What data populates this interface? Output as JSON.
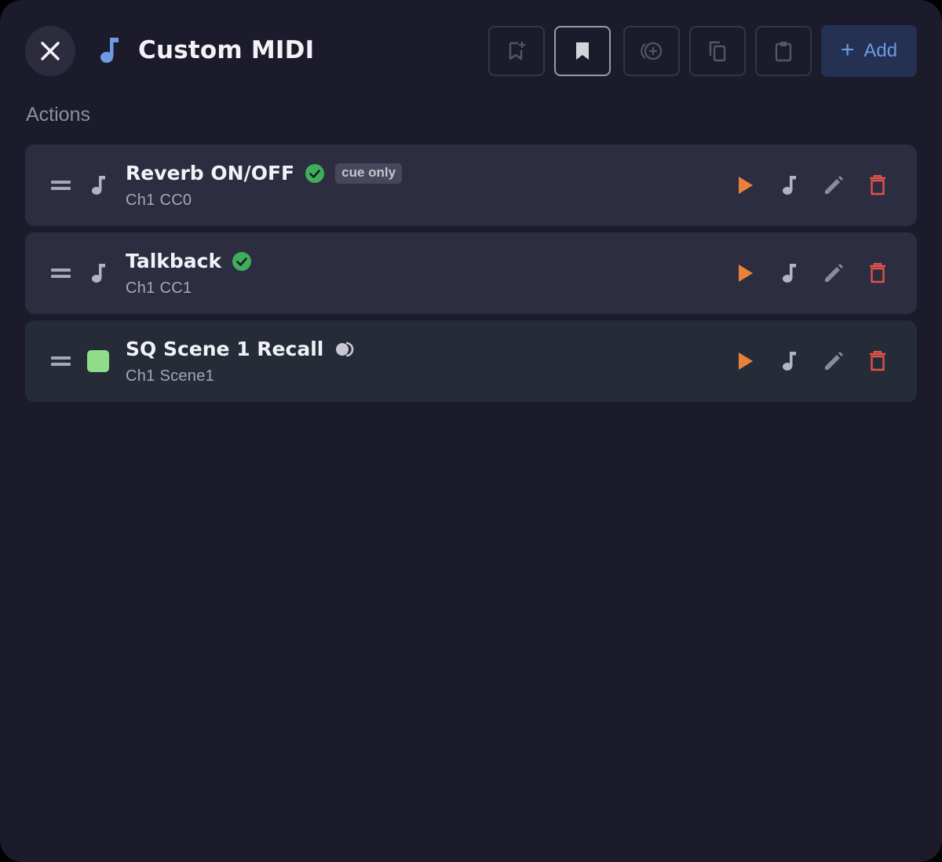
{
  "header": {
    "title": "Custom MIDI",
    "close_icon": "close-icon",
    "title_icon": "music-note-icon",
    "toolbar": [
      {
        "name": "bookmark-add-button",
        "icon": "bookmark-add-icon",
        "active": false
      },
      {
        "name": "bookmark-button",
        "icon": "bookmark-icon",
        "active": true
      },
      {
        "name": "add-circle-button",
        "icon": "add-circle-icon",
        "active": false
      },
      {
        "name": "copy-button",
        "icon": "copy-icon",
        "active": false
      },
      {
        "name": "paste-button",
        "icon": "clipboard-icon",
        "active": false
      }
    ],
    "add_label": "Add",
    "add_symbol": "+"
  },
  "section_label": "Actions",
  "actions": [
    {
      "name": "Reverb ON/OFF",
      "sub": "Ch1 CC0",
      "status": "check",
      "badge": "cue only",
      "icon": "music-note-icon"
    },
    {
      "name": "Talkback",
      "sub": "Ch1 CC1",
      "status": "check",
      "icon": "music-note-icon"
    },
    {
      "name": "SQ Scene 1 Recall",
      "sub": "Ch1 Scene1",
      "status": "toggle",
      "swatch": "#8fdc8a"
    }
  ],
  "colors": {
    "background": "#1b1b2b",
    "row": "#2d2d42",
    "row_alt": "#252c37",
    "accent_blue": "#6e9ae6",
    "play_orange": "#e8813a",
    "delete_red": "#e0524a",
    "check_green": "#3fae5a"
  }
}
